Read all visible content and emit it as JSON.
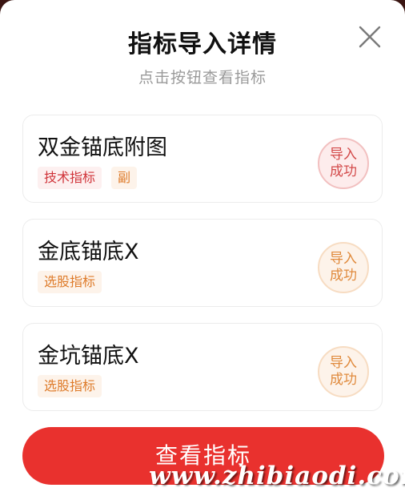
{
  "dialog": {
    "title": "指标导入详情",
    "subtitle": "点击按钮查看指标",
    "close_icon": "close-icon"
  },
  "items": [
    {
      "name": "双金锚底附图",
      "tags": [
        "技术指标",
        "副"
      ],
      "status": [
        "导入",
        "成功"
      ],
      "status_color": "#d34a4a"
    },
    {
      "name": "金底锚底X",
      "tags": [
        "选股指标"
      ],
      "status": [
        "导入",
        "成功"
      ],
      "status_color": "#e08a3c"
    },
    {
      "name": "金坑锚底X",
      "tags": [
        "选股指标"
      ],
      "status": [
        "导入",
        "成功"
      ],
      "status_color": "#e08a3c"
    }
  ],
  "action": {
    "label": "查看指标",
    "color": "#e9312e"
  },
  "watermark": "www.zhibiaodi.com"
}
